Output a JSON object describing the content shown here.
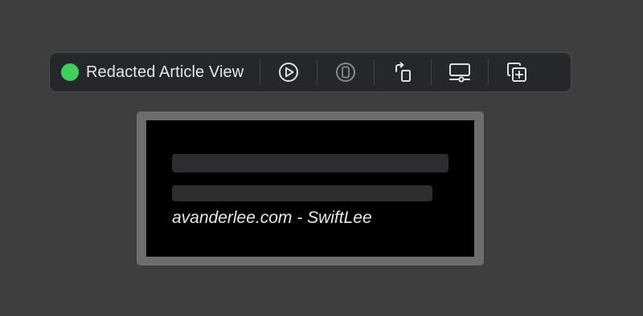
{
  "toolbar": {
    "title": "Redacted Article View",
    "status_color": "#3fd05b",
    "buttons": [
      {
        "icon": "live-preview-play-icon"
      },
      {
        "icon": "device-preview-icon"
      },
      {
        "icon": "rotate-orientation-icon"
      },
      {
        "icon": "device-settings-icon"
      },
      {
        "icon": "duplicate-preview-icon"
      }
    ]
  },
  "preview": {
    "byline": "avanderlee.com - SwiftLee"
  },
  "colors": {
    "background": "#3e3e3e",
    "toolbar_bg": "#26272b",
    "preview_frame": "#6d6d6d",
    "preview_bg": "#000000",
    "redaction_placeholder": "#2d2d2f"
  }
}
